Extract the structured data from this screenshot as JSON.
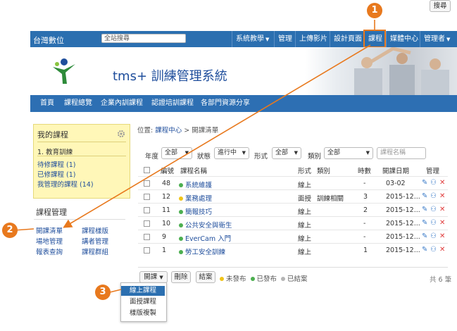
{
  "topnav": {
    "brand": "台灣數位",
    "search_placeholder": "全站搜尋",
    "items": [
      "系統教學",
      "管理",
      "上傳影片",
      "設計頁面",
      "課程",
      "媒體中心",
      "管理者"
    ]
  },
  "header": {
    "title": "tms+ 訓練管理系統"
  },
  "mainnav": [
    "首頁",
    "課程總覽",
    "企業內訓課程",
    "認證培訓課程",
    "各部門資源分享"
  ],
  "mycourse": {
    "title": "我的課程",
    "lines": [
      "1. 教育訓練",
      "待修課程 (1)",
      "已修課程 (1)",
      "我管理的課程 (14)"
    ]
  },
  "mgmt": {
    "title": "課程管理",
    "links": [
      "開課清單",
      "課程樣版",
      "場地管理",
      "講者管理",
      "報表查詢",
      "課程群組"
    ]
  },
  "breadcrumb": {
    "prefix": "位置:",
    "section": "課程中心",
    "sep": ">",
    "current": "開課清單"
  },
  "filters": {
    "year_label": "年度",
    "year_value": "全部",
    "status_label": "狀態",
    "status_value": "進行中",
    "form_label": "形式",
    "form_value": "全部",
    "category_label": "類別",
    "category_value": "全部",
    "search_placeholder": "課程名稱",
    "search_button": "搜尋"
  },
  "table": {
    "headers": [
      "編號",
      "課程名稱",
      "形式",
      "類別",
      "時數",
      "開課日期",
      "管理"
    ],
    "rows": [
      {
        "id": "48",
        "status": "published",
        "name": "系統維護",
        "form": "線上",
        "category": "",
        "hours": "-",
        "date": "03-02"
      },
      {
        "id": "12",
        "status": "unpublished",
        "name": "業務處理",
        "form": "面授",
        "category": "訓練相關",
        "hours": "3",
        "date": "2015-12..."
      },
      {
        "id": "11",
        "status": "published",
        "name": "簡報技巧",
        "form": "線上",
        "category": "",
        "hours": "2",
        "date": "2015-12..."
      },
      {
        "id": "10",
        "status": "published",
        "name": "公共安全與衛生",
        "form": "線上",
        "category": "",
        "hours": "-",
        "date": "2015-12..."
      },
      {
        "id": "9",
        "status": "published",
        "name": "EverCam 入門",
        "form": "線上",
        "category": "",
        "hours": "-",
        "date": "2015-12..."
      },
      {
        "id": "1",
        "status": "published",
        "name": "勞工安全訓練",
        "form": "線上",
        "category": "",
        "hours": "1",
        "date": "2015-12..."
      }
    ]
  },
  "actions": {
    "open_button": "開課",
    "delete_button": "刪除",
    "close_button": "結案",
    "legend": [
      {
        "label": "未發布",
        "color": "#f0c419"
      },
      {
        "label": "已發布",
        "color": "#4caf50"
      },
      {
        "label": "已結案",
        "color": "#b5b5b5"
      }
    ],
    "total": "共 6 筆"
  },
  "dropdown": [
    "線上課程",
    "面授課程",
    "樣版複製"
  ],
  "badges": [
    "1",
    "2",
    "3"
  ],
  "colors": {
    "accent": "#e8791e",
    "brand": "#2b6fb0",
    "link": "#1f4e9c"
  }
}
